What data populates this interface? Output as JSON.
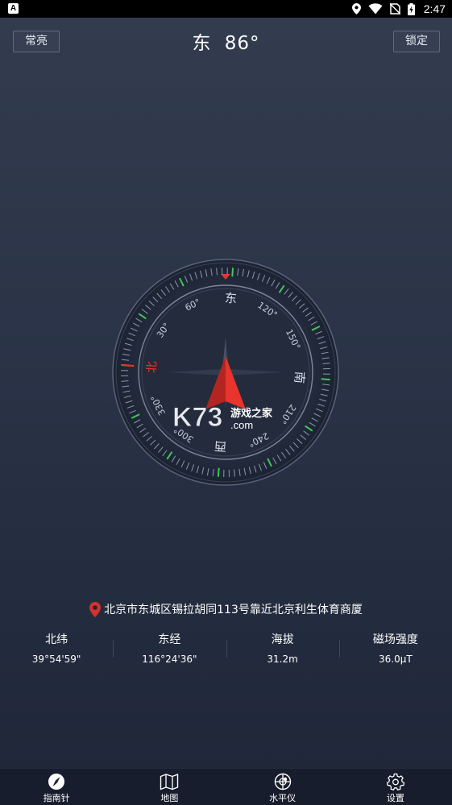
{
  "status_bar": {
    "notification_glyph": "A",
    "icons": [
      "location-icon",
      "wifi-icon",
      "no-sim-icon",
      "battery-charging-icon"
    ],
    "time": "2:47"
  },
  "header": {
    "always_on_label": "常亮",
    "direction": "东",
    "degrees": "86°",
    "lock_label": "锁定"
  },
  "compass": {
    "heading_value": 86,
    "rotation": -86,
    "cardinals": {
      "north": "北",
      "east": "东",
      "south": "南",
      "west": "西"
    },
    "degree_labels": [
      "30°",
      "60°",
      "120°",
      "150°",
      "210°",
      "240°",
      "300°",
      "330°"
    ],
    "north_color": "#e8342c",
    "tick_color": "#8c97ad",
    "accent_tick_color": "#3fc757"
  },
  "watermark": {
    "brand": "K73",
    "tagline": "游戏之家",
    "domain": ".com"
  },
  "location": {
    "address": "北京市东城区锡拉胡同113号靠近北京利生体育商厦",
    "stats": [
      {
        "label": "北纬",
        "value": "39°54'59\""
      },
      {
        "label": "东经",
        "value": "116°24'36\""
      },
      {
        "label": "海拔",
        "value": "31.2m"
      },
      {
        "label": "磁场强度",
        "value": "36.0μT"
      }
    ]
  },
  "bottom_nav": [
    {
      "label": "指南针",
      "icon": "compass-icon"
    },
    {
      "label": "地图",
      "icon": "map-icon"
    },
    {
      "label": "水平仪",
      "icon": "level-icon"
    },
    {
      "label": "设置",
      "icon": "settings-icon"
    }
  ]
}
